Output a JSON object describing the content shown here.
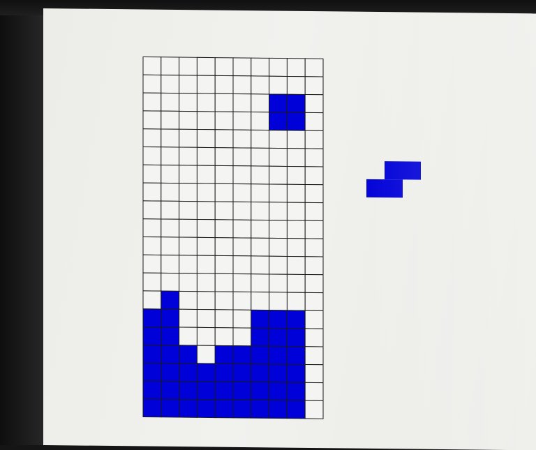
{
  "game": {
    "name": "tetris",
    "board": {
      "cols": 10,
      "rows": 20,
      "filled_color": "#0000d8",
      "empty_color": "#f4f4f2",
      "grid_line_color": "#1a1a1a",
      "cells": [
        "..........",
        "..........",
        ".......##.",
        ".......##.",
        "..........",
        "..........",
        "..........",
        "..........",
        "..........",
        "..........",
        "..........",
        "..........",
        "..........",
        ".#........",
        "##....###.",
        "##....###.",
        "###.#####.",
        "#########.",
        "#########.",
        "#########."
      ]
    },
    "next_piece": {
      "type": "S",
      "color": "#0000d8",
      "cells": [
        ".##",
        "##."
      ]
    }
  }
}
